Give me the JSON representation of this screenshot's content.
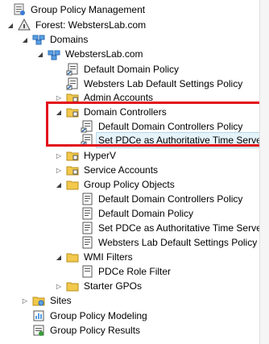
{
  "tree": {
    "root": "Group Policy Management",
    "forest": "Forest: WebstersLab.com",
    "domains": "Domains",
    "domain": "WebstersLab.com",
    "default_domain_policy": "Default Domain Policy",
    "default_settings_policy": "Websters Lab Default Settings Policy",
    "admin_accounts": "Admin Accounts",
    "domain_controllers": "Domain Controllers",
    "dc_policy": "Default Domain Controllers Policy",
    "pdce_policy": "Set PDCe as Authoritative Time Server",
    "hyperv": "HyperV",
    "service_accounts": "Service Accounts",
    "gpo": "Group Policy Objects",
    "gpo_dc_policy": "Default Domain Controllers Policy",
    "gpo_default_domain": "Default Domain Policy",
    "gpo_pdce": "Set PDCe as Authoritative Time Server",
    "gpo_websters": "Websters Lab Default Settings Policy",
    "wmi_filters": "WMI Filters",
    "pdce_role_filter": "PDCe Role Filter",
    "starter_gpos": "Starter GPOs",
    "sites": "Sites",
    "modeling": "Group Policy Modeling",
    "results": "Group Policy Results"
  }
}
